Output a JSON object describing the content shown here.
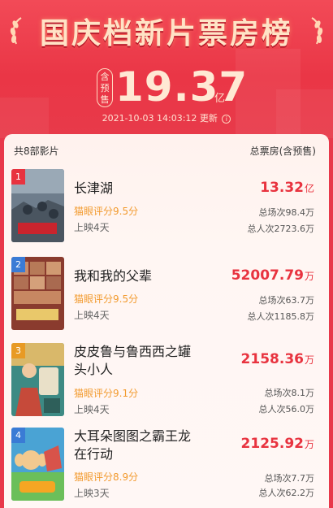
{
  "header": {
    "title": "国庆档新片票房榜",
    "badge": "含预售",
    "total": "19.37",
    "total_unit": "亿",
    "update_time": "2021-10-03 14:03:12 更新",
    "info_icon": "i"
  },
  "list": {
    "count_label": "共8部影片",
    "box_header": "总票房(含预售)"
  },
  "movies": [
    {
      "rank": "1",
      "name": "长津湖",
      "score": "猫眼评分9.5分",
      "days": "上映4天",
      "box": "13.32",
      "box_unit": "亿",
      "shows": "总场次98.4万",
      "people": "总人次2723.6万"
    },
    {
      "rank": "2",
      "name": "我和我的父辈",
      "score": "猫眼评分9.5分",
      "days": "上映4天",
      "box": "52007.79",
      "box_unit": "万",
      "shows": "总场次63.7万",
      "people": "总人次1185.8万"
    },
    {
      "rank": "3",
      "name": "皮皮鲁与鲁西西之罐头小人",
      "score": "猫眼评分9.1分",
      "days": "上映4天",
      "box": "2158.36",
      "box_unit": "万",
      "shows": "总场次8.1万",
      "people": "总人次56.0万"
    },
    {
      "rank": "4",
      "name": "大耳朵图图之霸王龙在行动",
      "score": "猫眼评分8.9分",
      "days": "上映3天",
      "box": "2125.92",
      "box_unit": "万",
      "shows": "总场次7.7万",
      "people": "总人次62.2万"
    }
  ],
  "colors": {
    "accent": "#e8333f",
    "score": "#f29a2e",
    "header_bg": "#ea3646"
  }
}
